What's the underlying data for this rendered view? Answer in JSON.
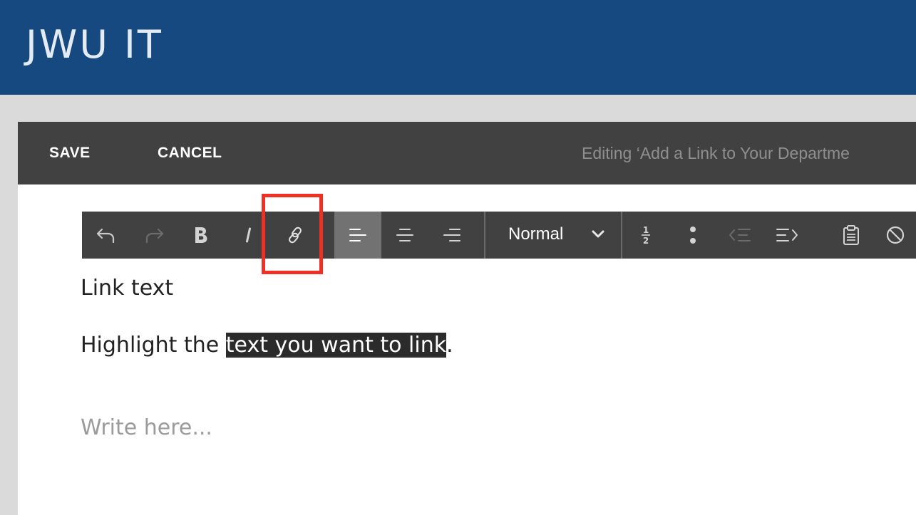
{
  "header": {
    "title": "JWU IT"
  },
  "editor_bar": {
    "save_label": "SAVE",
    "cancel_label": "CANCEL",
    "editing_text": "Editing ‘Add a Link to Your Departme"
  },
  "toolbar": {
    "buttons": [
      {
        "name": "undo-icon",
        "enabled": true
      },
      {
        "name": "redo-icon",
        "enabled": false
      },
      {
        "name": "bold-icon"
      },
      {
        "name": "italic-icon"
      },
      {
        "name": "link-icon",
        "highlighted": true
      },
      {
        "name": "align-left-icon",
        "active": true
      },
      {
        "name": "align-center-icon"
      },
      {
        "name": "align-right-icon"
      },
      {
        "name": "ordered-list-icon"
      },
      {
        "name": "bullet-list-icon"
      },
      {
        "name": "outdent-icon",
        "enabled": false
      },
      {
        "name": "indent-icon"
      },
      {
        "name": "paste-icon"
      },
      {
        "name": "clear-format-icon"
      }
    ],
    "format_value": "Normal",
    "ordered_list_glyph_top": "1",
    "ordered_list_glyph_bottom": "2"
  },
  "content": {
    "line1": "Link text",
    "line2_prefix": "Highlight the ",
    "line2_selected": "text you want to link",
    "line2_suffix": ".",
    "placeholder": "Write here..."
  },
  "colors": {
    "header_bg": "#154980",
    "bar_bg": "#414141",
    "highlight": "#f03024",
    "selection_bg": "#2b2b2b"
  }
}
